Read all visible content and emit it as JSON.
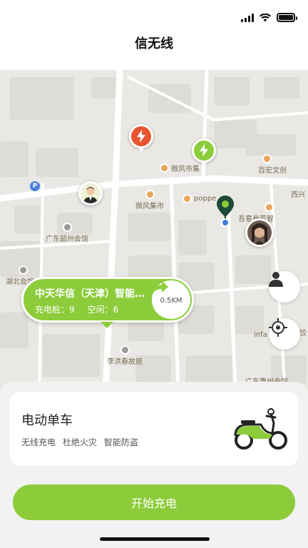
{
  "app": {
    "title": "信无线"
  },
  "colors": {
    "accent": "#8ccc3a",
    "alert": "#e85530"
  },
  "map": {
    "pois": [
      {
        "label": "微风市集",
        "icon": "poi-icon"
      },
      {
        "label": "微风集市",
        "icon": "poi-icon"
      },
      {
        "label": "poppe",
        "icon": "poi-icon"
      },
      {
        "label": "百宏文创",
        "icon": "poi-icon"
      },
      {
        "label": "吾意悬若智",
        "icon": "poi-icon"
      },
      {
        "label": "西兴",
        "icon": ""
      },
      {
        "label": "广东韶州会馆",
        "icon": "poi-icon"
      },
      {
        "label": "湖北会馆",
        "icon": "poi-icon"
      },
      {
        "label": "李洪春故居",
        "icon": "poi-icon"
      },
      {
        "label": "infa",
        "icon": ""
      },
      {
        "label": "饺",
        "icon": "poi-icon"
      },
      {
        "label": "广东惠州会馆",
        "icon": ""
      },
      {
        "label": "P",
        "icon": "parking-icon"
      }
    ],
    "station": {
      "name": "中天华信（天津）智能科技有限公司",
      "pile_label": "充电桩：9",
      "free_label": "空闲：6",
      "distance": "0.5KM"
    }
  },
  "vehicle": {
    "title": "电动单车",
    "features": [
      "无线充电",
      "杜绝火灾",
      "智能防盗"
    ]
  },
  "actions": {
    "start_label": "开始充电"
  }
}
